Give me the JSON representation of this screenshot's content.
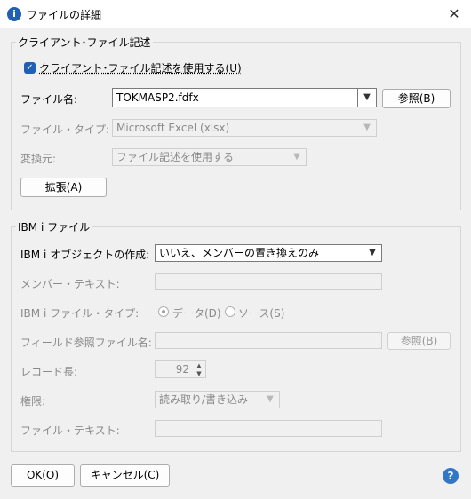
{
  "window": {
    "title": "ファイルの詳細",
    "close_glyph": "✕",
    "app_icon": "i"
  },
  "client_group": {
    "title": "クライアント･ファイル記述",
    "use_checkbox_label": "クライアント･ファイル記述を使用する(U)",
    "use_checked": true,
    "filename_label": "ファイル名:",
    "filename_value": "TOKMASP2.fdfx",
    "browse_label": "参照(B)",
    "filetype_label": "ファイル・タイプ:",
    "filetype_value": "Microsoft Excel (xlsx)",
    "convert_label": "変換元:",
    "convert_value": "ファイル記述を使用する",
    "extend_label": "拡張(A)"
  },
  "ibmi_group": {
    "title": "IBM i ファイル",
    "create_label": "IBM i オブジェクトの作成:",
    "create_value": "いいえ、メンバーの置き換えのみ",
    "member_text_label": "メンバー・テキスト:",
    "member_text_value": "",
    "file_type_label": "IBM i ファイル・タイプ:",
    "radio_data_label": "データ(D)",
    "radio_source_label": "ソース(S)",
    "field_ref_label": "フィールド参照ファイル名:",
    "field_ref_value": "",
    "field_ref_browse_label": "参照(B)",
    "record_len_label": "レコード長:",
    "record_len_value": "92",
    "authority_label": "権限:",
    "authority_value": "読み取り/書き込み",
    "file_text_label": "ファイル・テキスト:",
    "file_text_value": ""
  },
  "footer": {
    "ok_label": "OK(O)",
    "cancel_label": "キャンセル(C)",
    "help_glyph": "?"
  },
  "colors": {
    "accent": "#1f5fb4",
    "help": "#3277c6"
  },
  "icons": {
    "dropdown": "chevron-down-icon",
    "close": "close-icon",
    "help": "help-icon",
    "check": "checkmark-icon"
  }
}
